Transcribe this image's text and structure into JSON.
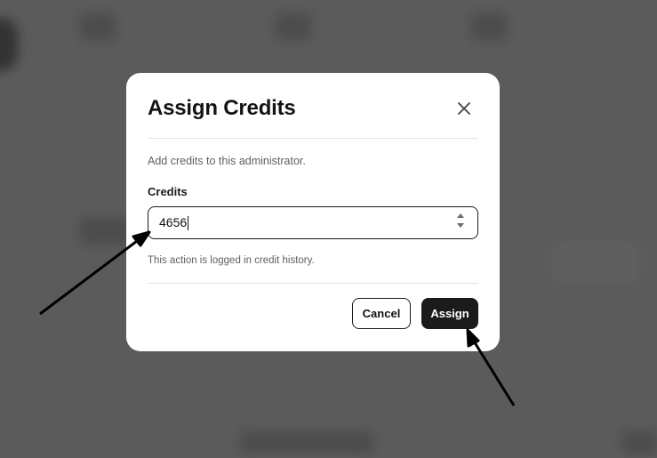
{
  "dialog": {
    "title": "Assign Credits",
    "description": "Add credits to this administrator.",
    "field_label": "Credits",
    "credits_value": "4656",
    "help_text": "This action is logged in credit history.",
    "cancel_label": "Cancel",
    "assign_label": "Assign",
    "close_icon": "close-icon",
    "stepper_icon": "stepper-arrows-icon"
  },
  "colors": {
    "primary_button": "#1b1b1b",
    "backdrop": "#6f6f6f"
  }
}
